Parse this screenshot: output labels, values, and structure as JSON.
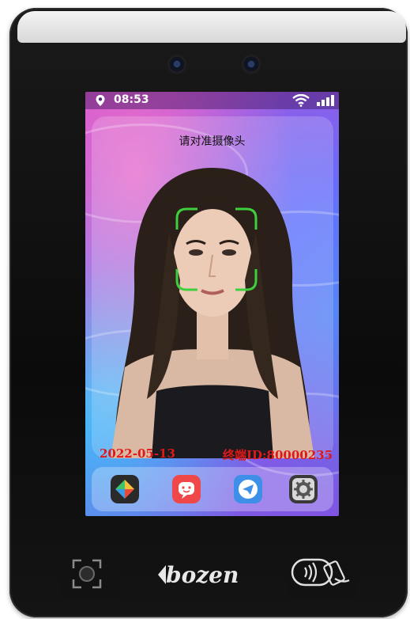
{
  "status_bar": {
    "time": "08:53",
    "location_icon": "location-pin-icon",
    "wifi_icon": "wifi-icon",
    "signal_icon": "signal-bars-icon"
  },
  "prompt": "请对准摄像头",
  "overlay": {
    "date": "2022-05-13",
    "device_id": "终端ID:80000235"
  },
  "dock_apps": [
    {
      "icon": "gallery-app-icon",
      "color": "#2a2a2a"
    },
    {
      "icon": "chat-app-icon",
      "color": "#f04848"
    },
    {
      "icon": "paper-plane-app-icon",
      "color": "#3d8fe8"
    },
    {
      "icon": "settings-gear-icon",
      "color": "#3a3a3a"
    }
  ],
  "brand": "bozen",
  "colors": {
    "overlay_text": "#e01818",
    "face_frame": "#3ecf3e"
  }
}
